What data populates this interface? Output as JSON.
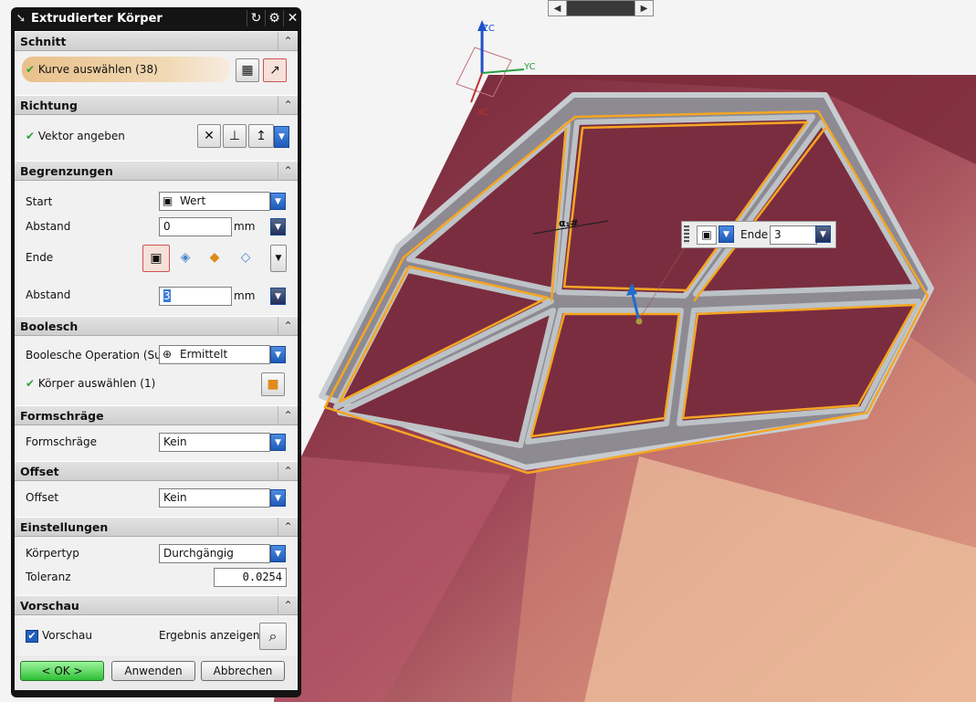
{
  "topbar": {
    "left_arrow": "◀",
    "right_arrow": "▶"
  },
  "axes": {
    "zc": "ZC",
    "yc": "YC",
    "xc": "XC"
  },
  "dialog": {
    "title": "Extrudierter Körper",
    "sections": {
      "schnitt": {
        "title": "Schnitt",
        "curve_label": "Kurve auswählen (38)"
      },
      "richtung": {
        "title": "Richtung",
        "vector_label": "Vektor angeben"
      },
      "begrenzungen": {
        "title": "Begrenzungen",
        "start_label": "Start",
        "start_value": "Wert",
        "abstand1_label": "Abstand",
        "abstand1_value": "0",
        "unit1": "mm",
        "ende_label": "Ende",
        "abstand2_label": "Abstand",
        "abstand2_value": "3",
        "unit2": "mm"
      },
      "boolesch": {
        "title": "Boolesch",
        "operation_label": "Boolesche Operation (Su",
        "operation_value": "Ermittelt",
        "body_label": "Körper auswählen (1)"
      },
      "formschraege": {
        "title": "Formschräge",
        "label": "Formschräge",
        "value": "Kein"
      },
      "offset": {
        "title": "Offset",
        "label": "Offset",
        "value": "Kein"
      },
      "einstellungen": {
        "title": "Einstellungen",
        "koerpertyp_label": "Körpertyp",
        "koerpertyp_value": "Durchgängig",
        "toleranz_label": "Toleranz",
        "toleranz_value": "0.0254"
      },
      "vorschau": {
        "title": "Vorschau",
        "checkbox_label": "Vorschau",
        "result_label": "Ergebnis anzeigen"
      }
    },
    "buttons": {
      "ok": "< OK >",
      "apply": "Anwenden",
      "cancel": "Abbrechen"
    }
  },
  "onscreen_input": {
    "label": "Ende",
    "value": "3"
  },
  "dimension_label": "α₁#",
  "colors": {
    "accent": "#f5a623",
    "title_bg": "#141414",
    "ok_green": "#2fbf36",
    "brand_blue": "#1e5bb8"
  }
}
